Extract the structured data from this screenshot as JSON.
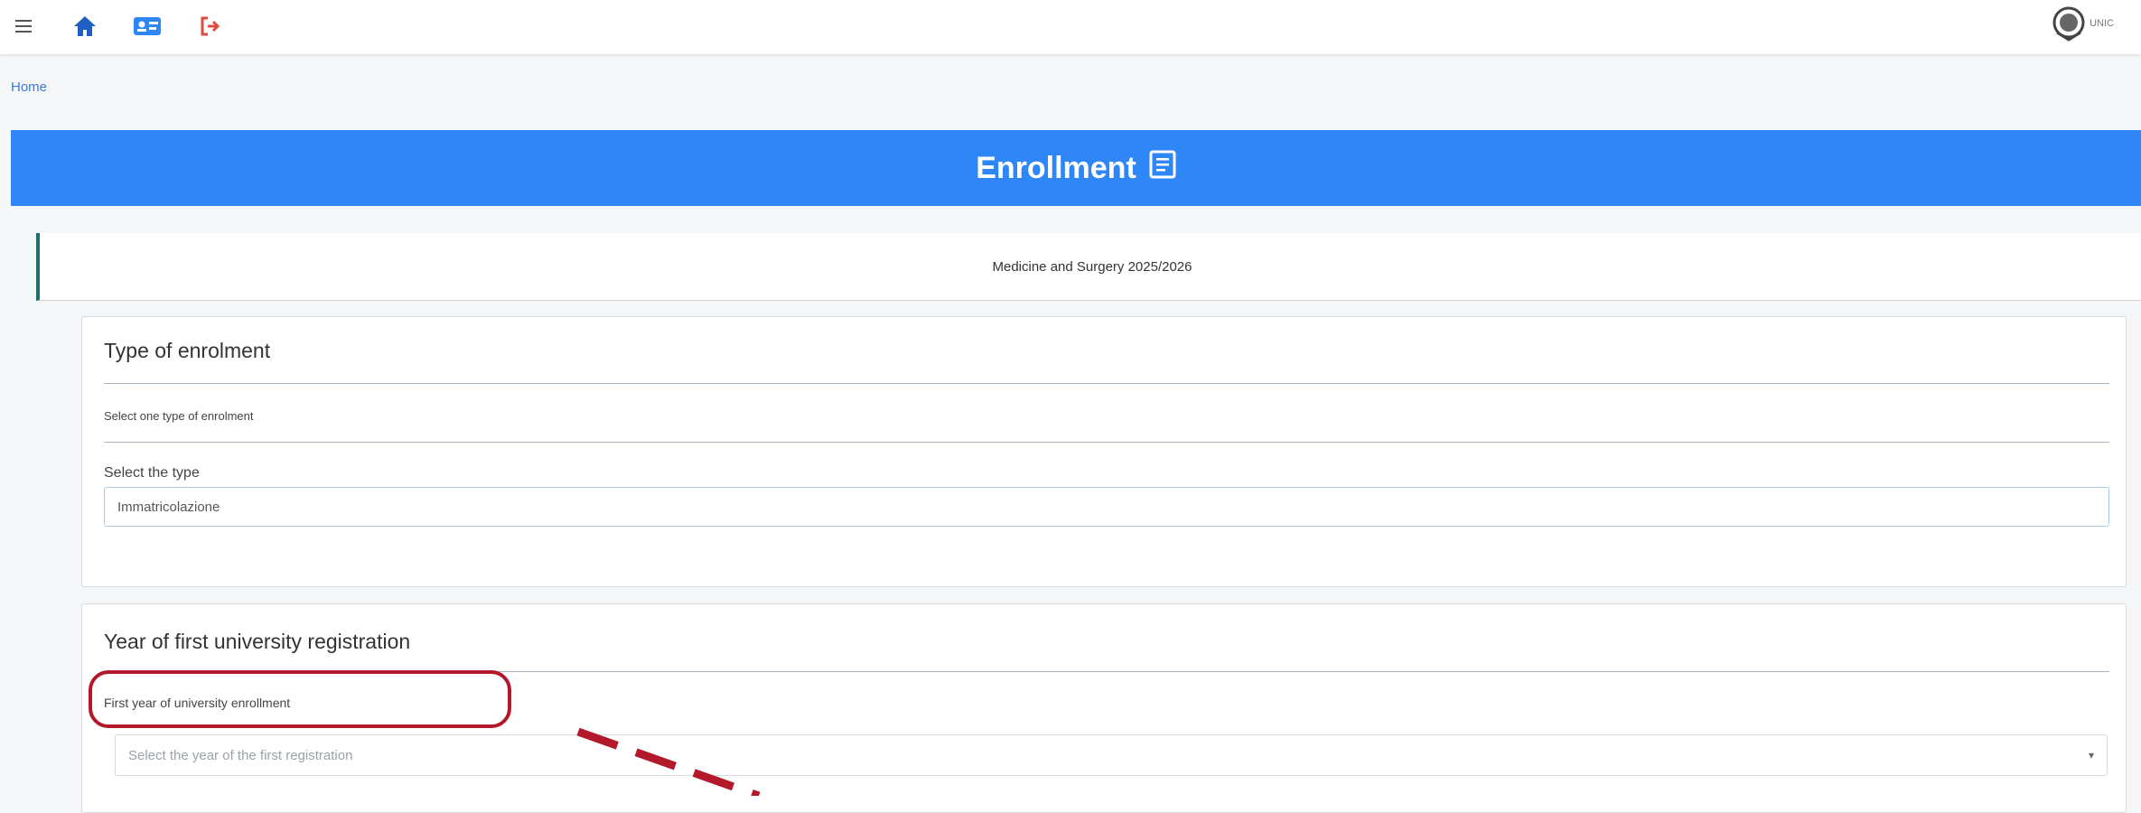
{
  "topbar": {
    "icons": [
      "menu-icon",
      "home-icon",
      "id-card-icon",
      "logout-icon"
    ],
    "logo_text": "UNIC"
  },
  "breadcrumb": "Home",
  "banner": {
    "title": "Enrollment",
    "icon": "book-icon"
  },
  "course": "Medicine and Surgery 2025/2026",
  "type_section": {
    "title": "Type of enrolment",
    "hint": "Select one type of enrolment",
    "field_label": "Select the type",
    "field_value": "Immatricolazione"
  },
  "year_section": {
    "title": "Year of first university registration",
    "field_label": "First year of university enrollment",
    "placeholder": "Select the year of the first registration"
  },
  "colors": {
    "accent": "#2f86f6",
    "highlight": "#b3192a",
    "logout": "#e04a3f"
  }
}
